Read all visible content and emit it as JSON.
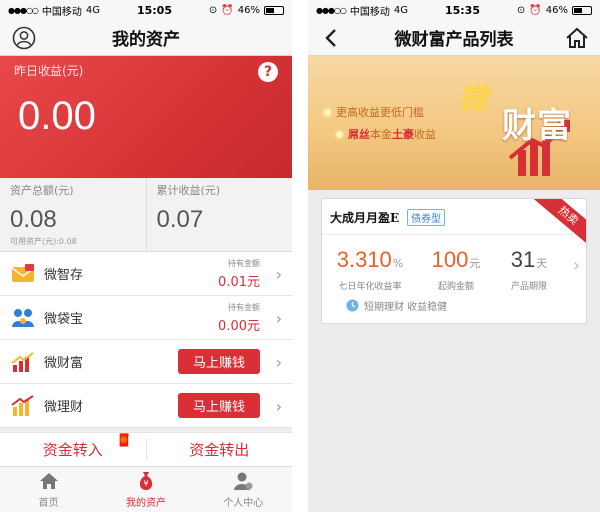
{
  "status_bars": {
    "left": {
      "signal": "●●●○○",
      "carrier": "中国移动",
      "network": "4G",
      "time": "15:05",
      "battery": "46%"
    },
    "right": {
      "signal": "●●●○○",
      "carrier": "中国移动",
      "network": "4G",
      "time": "15:35",
      "battery": "46%"
    }
  },
  "assets_screen": {
    "title": "我的资产",
    "yesterday_earnings_label": "昨日收益(元)",
    "yesterday_earnings_value": "0.00",
    "help_symbol": "?",
    "total_assets_label": "资产总额(元)",
    "total_assets_value": "0.08",
    "available_assets": "可用资产(元):0.08",
    "cumulative_earnings_label": "累计收益(元)",
    "cumulative_earnings_value": "0.07",
    "products": [
      {
        "name": "微智存",
        "hold_label": "持有金额",
        "hold_value": "0.01元"
      },
      {
        "name": "微袋宝",
        "hold_label": "持有金额",
        "hold_value": "0.00元"
      },
      {
        "name": "微财富",
        "button": "马上赚钱"
      },
      {
        "name": "微理财",
        "button": "马上赚钱"
      }
    ],
    "transfer_in": "资金转入",
    "transfer_out": "资金转出",
    "tabs": [
      {
        "label": "首页",
        "icon": "home-icon"
      },
      {
        "label": "我的资产",
        "icon": "money-bag-icon"
      },
      {
        "label": "个人中心",
        "icon": "user-icon"
      }
    ],
    "accent_color": "#d62f35"
  },
  "product_list_screen": {
    "title": "微财富产品列表",
    "banner": {
      "line1": "更高收益更低门槛",
      "line2_part1": "屌丝",
      "line2_part2": "本金",
      "line2_part3": "土豪",
      "line2_part4": "收益",
      "logo_wei": "微",
      "logo_text": "财富"
    },
    "product": {
      "name": "大成月月盈E",
      "tag": "债券型",
      "ribbon": "热卖",
      "rate_value": "3.310",
      "rate_unit": "%",
      "rate_label": "七日年化收益率",
      "min_value": "100",
      "min_unit": "元",
      "min_label": "起购金额",
      "term_value": "31",
      "term_unit": "天",
      "term_label": "产品期限",
      "footer": "短期理财 收益稳健"
    }
  }
}
